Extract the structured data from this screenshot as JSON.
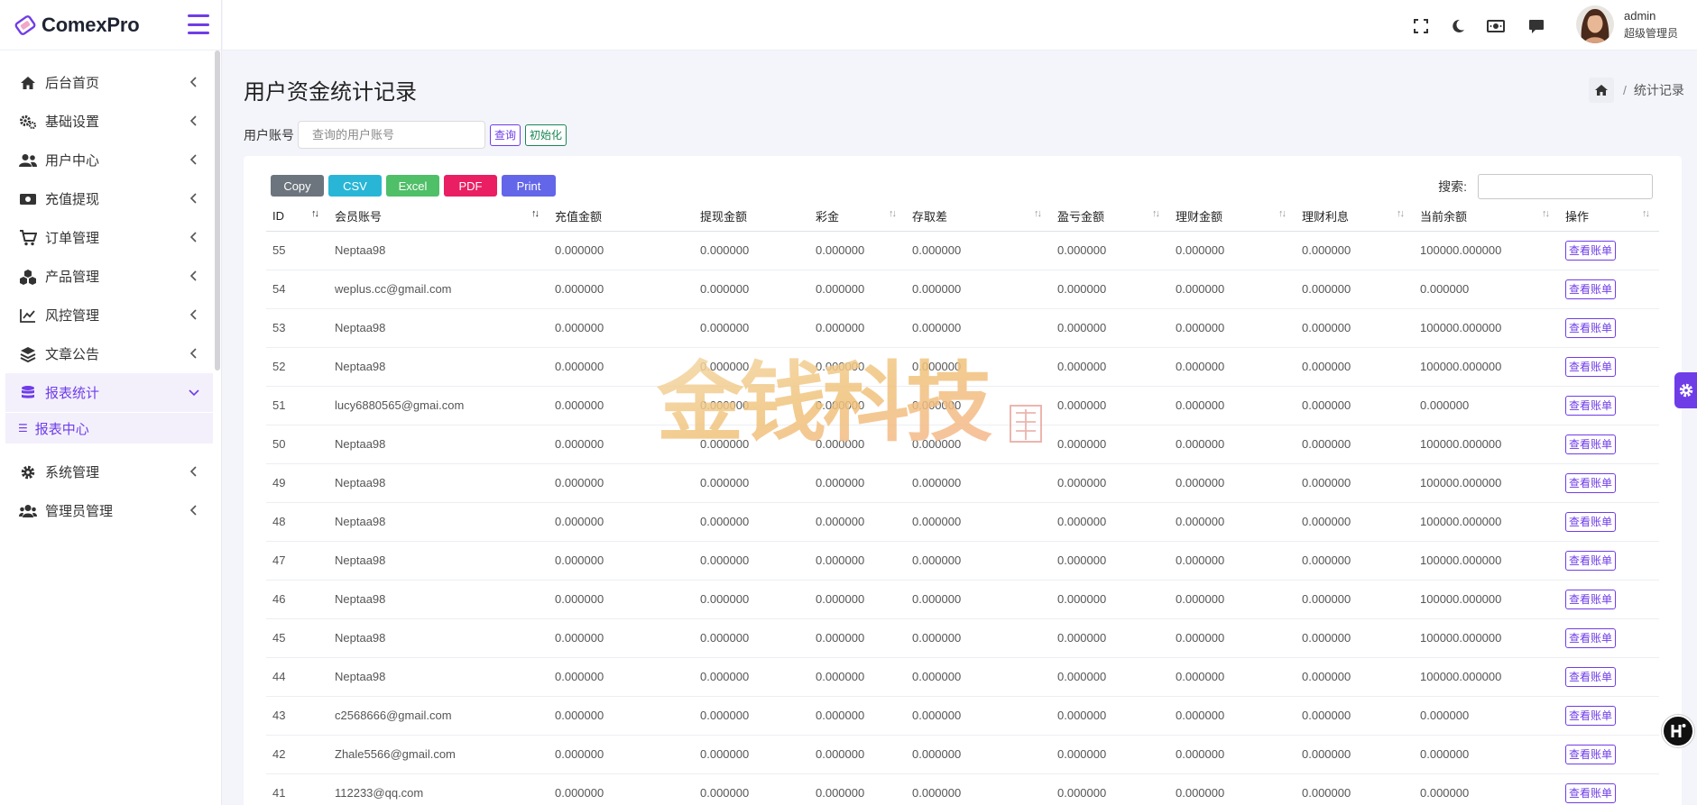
{
  "brand": {
    "name": "ComexPro"
  },
  "sidebar": {
    "items": [
      {
        "label": "后台首页",
        "icon": "home-icon"
      },
      {
        "label": "基础设置",
        "icon": "cogs-icon"
      },
      {
        "label": "用户中心",
        "icon": "users-icon"
      },
      {
        "label": "充值提现",
        "icon": "money-icon"
      },
      {
        "label": "订单管理",
        "icon": "cart-icon"
      },
      {
        "label": "产品管理",
        "icon": "cubes-icon"
      },
      {
        "label": "风控管理",
        "icon": "chart-line-icon"
      },
      {
        "label": "文章公告",
        "icon": "layers-icon"
      },
      {
        "label": "报表统计",
        "icon": "database-icon",
        "active": true,
        "sub": [
          {
            "label": "报表中心",
            "icon": "list-icon"
          }
        ]
      },
      {
        "label": "系统管理",
        "icon": "cog-icon"
      },
      {
        "label": "管理员管理",
        "icon": "users-icon"
      }
    ]
  },
  "header": {
    "icons": [
      "fullscreen-icon",
      "moon-icon",
      "money-icon",
      "comment-icon"
    ],
    "user": {
      "name": "admin",
      "role": "超级管理员"
    }
  },
  "page": {
    "title": "用户资金统计记录",
    "breadcrumb": {
      "current": "统计记录"
    }
  },
  "search": {
    "label": "用户账号",
    "placeholder": "查询的用户账号",
    "query_label": "查询",
    "init_label": "初始化"
  },
  "export": {
    "buttons": [
      {
        "label": "Copy",
        "color": "#6c757d"
      },
      {
        "label": "CSV",
        "color": "#29b6d6"
      },
      {
        "label": "Excel",
        "color": "#4fbf68"
      },
      {
        "label": "PDF",
        "color": "#e91e63"
      },
      {
        "label": "Print",
        "color": "#6366e8"
      }
    ]
  },
  "table_search_label": "搜索:",
  "table": {
    "columns": [
      "ID",
      "会员账号",
      "充值金额",
      "提现金额",
      "彩金",
      "存取差",
      "盈亏金额",
      "理财金额",
      "理财利息",
      "当前余额",
      "操作"
    ],
    "rows": [
      [
        "55",
        "Neptaa98",
        "0.000000",
        "0.000000",
        "0.000000",
        "0.000000",
        "0.000000",
        "0.000000",
        "0.000000",
        "100000.000000"
      ],
      [
        "54",
        "weplus.cc@gmail.com",
        "0.000000",
        "0.000000",
        "0.000000",
        "0.000000",
        "0.000000",
        "0.000000",
        "0.000000",
        "0.000000"
      ],
      [
        "53",
        "Neptaa98",
        "0.000000",
        "0.000000",
        "0.000000",
        "0.000000",
        "0.000000",
        "0.000000",
        "0.000000",
        "100000.000000"
      ],
      [
        "52",
        "Neptaa98",
        "0.000000",
        "0.000000",
        "0.000000",
        "0.000000",
        "0.000000",
        "0.000000",
        "0.000000",
        "100000.000000"
      ],
      [
        "51",
        "lucy6880565@gmai.com",
        "0.000000",
        "0.000000",
        "0.000000",
        "0.000000",
        "0.000000",
        "0.000000",
        "0.000000",
        "0.000000"
      ],
      [
        "50",
        "Neptaa98",
        "0.000000",
        "0.000000",
        "0.000000",
        "0.000000",
        "0.000000",
        "0.000000",
        "0.000000",
        "100000.000000"
      ],
      [
        "49",
        "Neptaa98",
        "0.000000",
        "0.000000",
        "0.000000",
        "0.000000",
        "0.000000",
        "0.000000",
        "0.000000",
        "100000.000000"
      ],
      [
        "48",
        "Neptaa98",
        "0.000000",
        "0.000000",
        "0.000000",
        "0.000000",
        "0.000000",
        "0.000000",
        "0.000000",
        "100000.000000"
      ],
      [
        "47",
        "Neptaa98",
        "0.000000",
        "0.000000",
        "0.000000",
        "0.000000",
        "0.000000",
        "0.000000",
        "0.000000",
        "100000.000000"
      ],
      [
        "46",
        "Neptaa98",
        "0.000000",
        "0.000000",
        "0.000000",
        "0.000000",
        "0.000000",
        "0.000000",
        "0.000000",
        "100000.000000"
      ],
      [
        "45",
        "Neptaa98",
        "0.000000",
        "0.000000",
        "0.000000",
        "0.000000",
        "0.000000",
        "0.000000",
        "0.000000",
        "100000.000000"
      ],
      [
        "44",
        "Neptaa98",
        "0.000000",
        "0.000000",
        "0.000000",
        "0.000000",
        "0.000000",
        "0.000000",
        "0.000000",
        "100000.000000"
      ],
      [
        "43",
        "c2568666@gmail.com",
        "0.000000",
        "0.000000",
        "0.000000",
        "0.000000",
        "0.000000",
        "0.000000",
        "0.000000",
        "0.000000"
      ],
      [
        "42",
        "Zhale5566@gmail.com",
        "0.000000",
        "0.000000",
        "0.000000",
        "0.000000",
        "0.000000",
        "0.000000",
        "0.000000",
        "0.000000"
      ],
      [
        "41",
        "112233@qq.com",
        "0.000000",
        "0.000000",
        "0.000000",
        "0.000000",
        "0.000000",
        "0.000000",
        "0.000000",
        "0.000000"
      ]
    ],
    "action_label": "查看账单"
  },
  "watermark": {
    "text": "金钱科技"
  },
  "colors": {
    "accent": "#6f3de8",
    "success": "#198754"
  }
}
